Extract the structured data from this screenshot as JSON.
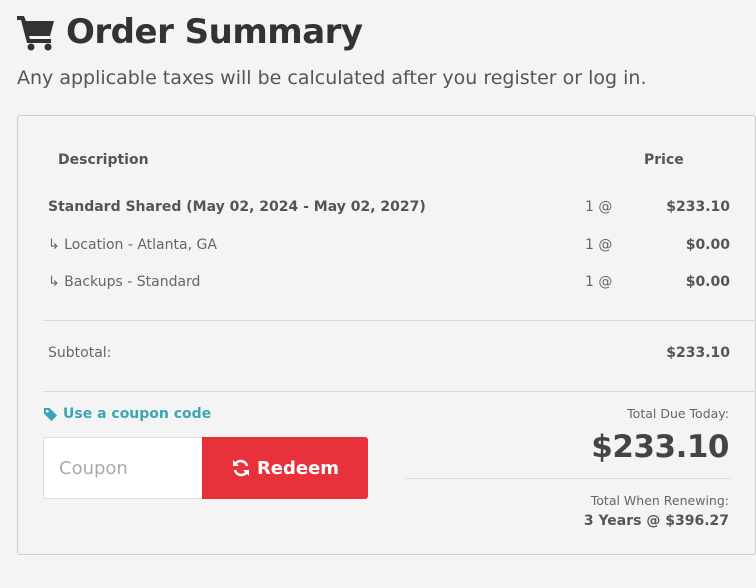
{
  "header": {
    "title": "Order Summary",
    "subtitle": "Any applicable taxes will be calculated after you register or log in.",
    "icon": "shopping-cart-icon"
  },
  "table": {
    "col_description": "Description",
    "col_price": "Price",
    "rows": [
      {
        "description": "Standard Shared (May 02, 2024 - May 02, 2027)",
        "qty": "1 @",
        "amount": "$233.10"
      },
      {
        "description": "↳ Location - Atlanta, GA",
        "qty": "1 @",
        "amount": "$0.00"
      },
      {
        "description": "↳ Backups - Standard",
        "qty": "1 @",
        "amount": "$0.00"
      }
    ],
    "subtotal_label": "Subtotal:",
    "subtotal_value": "$233.10"
  },
  "coupon": {
    "link_label": "Use a coupon code",
    "link_icon": "tag-icon",
    "placeholder": "Coupon",
    "value": "",
    "redeem_label": "Redeem",
    "redeem_icon": "refresh-icon"
  },
  "totals": {
    "due_today_label": "Total Due Today:",
    "due_today_value": "$233.10",
    "renewing_label": "Total When Renewing:",
    "renewing_value": "3 Years @ $396.27"
  },
  "colors": {
    "accent_teal": "#3aa5b3",
    "redeem_red": "#e8313a",
    "text_dark": "#444444",
    "background": "#f4f4f4"
  }
}
